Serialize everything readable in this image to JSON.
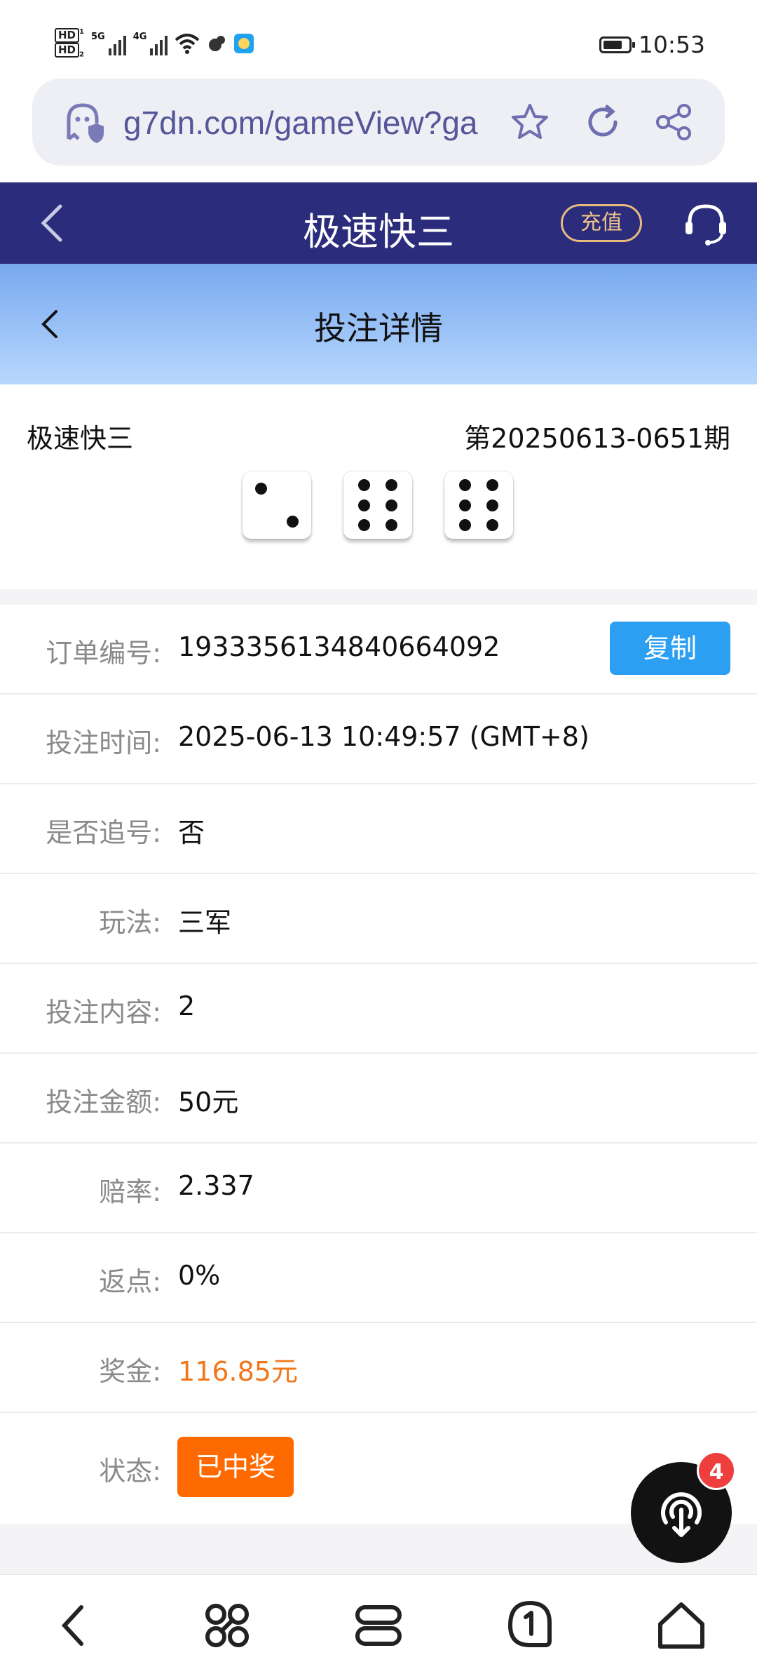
{
  "status_bar": {
    "hd1": "HD",
    "hd2": "HD",
    "net1": "5G",
    "net2": "4G",
    "time": "10:53"
  },
  "browser": {
    "url": "g7dn.com/gameView?ga"
  },
  "app_header": {
    "title": "极速快三",
    "recharge_label": "充值"
  },
  "sub_header": {
    "title": "投注详情"
  },
  "draw": {
    "game_name": "极速快三",
    "issue": "第20250613-0651期",
    "dice": [
      2,
      6,
      6
    ]
  },
  "details": {
    "order_label": "订单编号:",
    "order_value": "1933356134840664092",
    "copy_label": "复制",
    "time_label": "投注时间:",
    "time_value": "2025-06-13 10:49:57 (GMT+8)",
    "chase_label": "是否追号:",
    "chase_value": "否",
    "play_label": "玩法:",
    "play_value": "三军",
    "content_label": "投注内容:",
    "content_value": "2",
    "amount_label": "投注金额:",
    "amount_value": "50元",
    "odds_label": "赔率:",
    "odds_value": "2.337",
    "rebate_label": "返点:",
    "rebate_value": "0%",
    "prize_label": "奖金:",
    "prize_value": "116.85元",
    "status_label": "状态:",
    "status_value": "已中奖"
  },
  "fab": {
    "badge": "4"
  },
  "colors": {
    "header_bg": "#2b2d7c",
    "sub_header_top": "#78a9ef",
    "copy_button": "#2d9ff2",
    "prize_text": "#f2771b",
    "status_badge": "#ff6a00",
    "fab_badge": "#ef3e3e"
  },
  "icons": {
    "url_bar": [
      "ghost-shield-icon",
      "star-icon",
      "refresh-icon",
      "share-icon"
    ],
    "bottom_nav": [
      "back-arrow-icon",
      "command-icon",
      "tabs-icon",
      "notification-icon",
      "home-icon"
    ]
  }
}
